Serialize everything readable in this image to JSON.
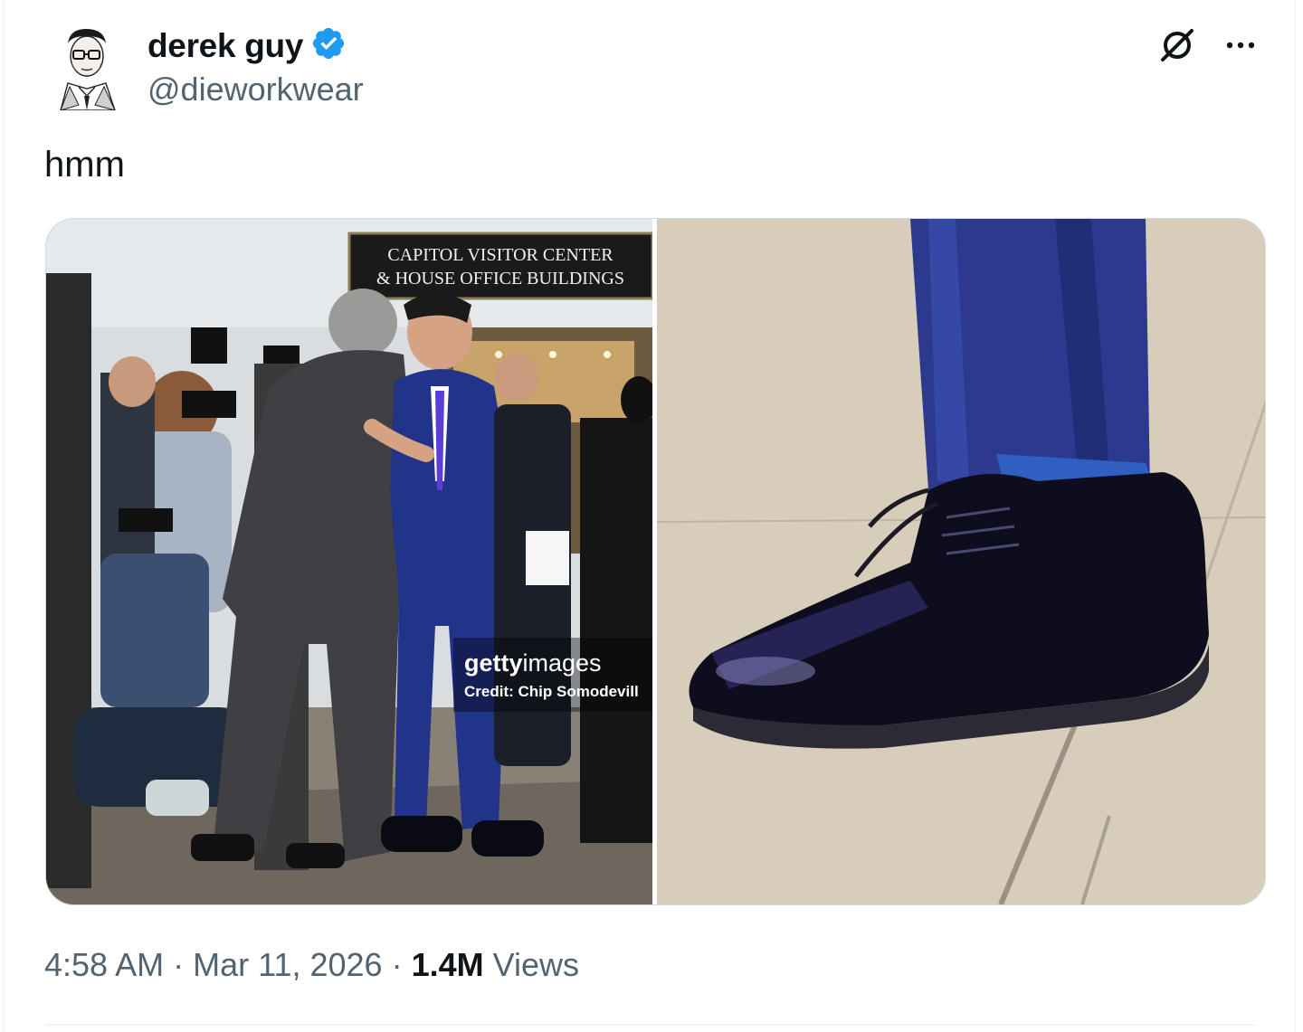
{
  "author": {
    "display_name": "derek guy",
    "handle": "@dieworkwear",
    "verified": true,
    "avatar": "illustrated-portrait"
  },
  "icons": {
    "verified": "verified-badge-icon",
    "grok": "grok-icon",
    "more": "more-options-icon"
  },
  "tweet": {
    "text": "hmm"
  },
  "media": {
    "left_photo": {
      "sign_line1": "CAPITOL VISITOR CENTER",
      "sign_line2": "& HOUSE OFFICE BUILDINGS",
      "watermark_brand_bold": "getty",
      "watermark_brand_light": "images",
      "watermark_credit": "Credit: Chip Somodevill"
    },
    "right_photo": "close-up-black-oxford-shoe"
  },
  "meta": {
    "time": "4:58 AM",
    "sep1": "·",
    "date": "Mar 11, 2026",
    "sep2": "·",
    "views_count": "1.4M",
    "views_label": "Views"
  },
  "colors": {
    "text_primary": "#0f1419",
    "text_secondary": "#536471",
    "verified_blue": "#1d9bf0",
    "border": "#cfd9de"
  }
}
